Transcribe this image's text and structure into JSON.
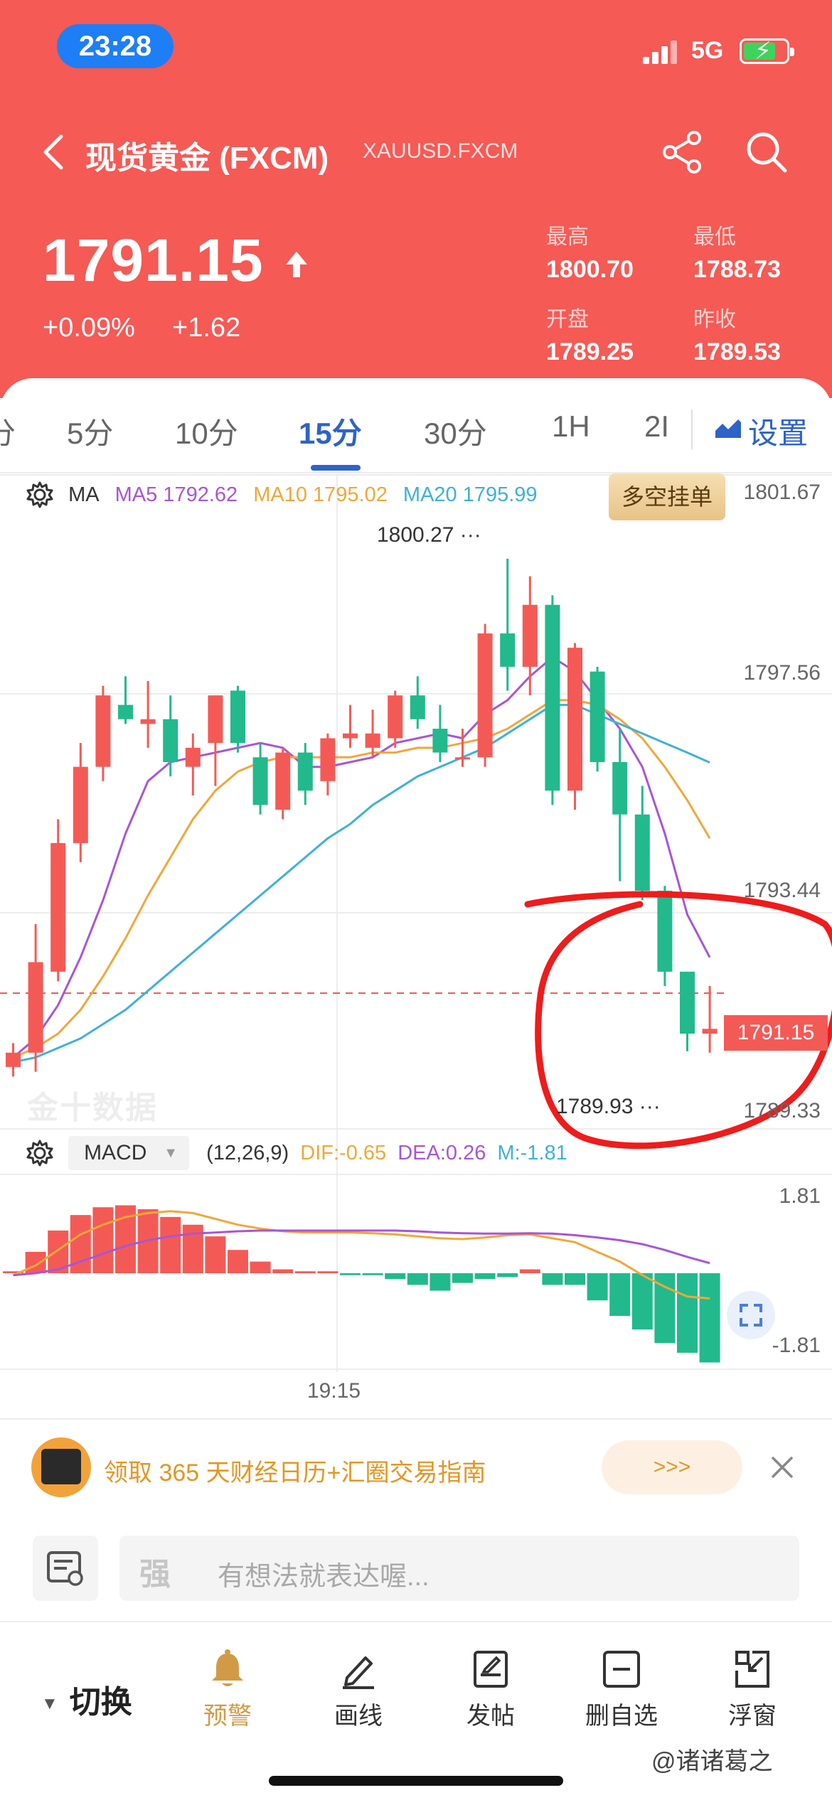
{
  "status_bar": {
    "time": "23:28",
    "network": "5G"
  },
  "nav": {
    "title": "现货黄金 (FXCM)",
    "symbol": "XAUUSD.FXCM"
  },
  "quote": {
    "price": "1791.15",
    "change_pct": "+0.09%",
    "change_abs": "+1.62",
    "high_label": "最高",
    "high": "1800.70",
    "low_label": "最低",
    "low": "1788.73",
    "open_label": "开盘",
    "open": "1789.25",
    "prev_close_label": "昨收",
    "prev_close": "1789.53"
  },
  "tabs": [
    {
      "label": "分"
    },
    {
      "label": "5分"
    },
    {
      "label": "10分"
    },
    {
      "label": "15分",
      "active": true
    },
    {
      "label": "30分"
    },
    {
      "label": "1H"
    },
    {
      "label": "2I"
    }
  ],
  "settings_label": "设置",
  "ma": {
    "label": "MA",
    "ma5": "MA5 1792.62",
    "ma10": "MA10 1795.02",
    "ma20": "MA20 1795.99",
    "colors": {
      "ma5": "#a855d6",
      "ma10": "#f0a73a",
      "ma20": "#3fb0d8"
    }
  },
  "orders_button": "多空挂单",
  "price_axis": [
    "1801.67",
    "1797.56",
    "1793.44",
    "1789.33"
  ],
  "current_price_tag": "1791.15",
  "high_marker": "1800.27 ···",
  "low_marker": "1789.93 ···",
  "watermark": "金十数据",
  "macd": {
    "name": "MACD",
    "params": "(12,26,9)",
    "dif": "DIF:-0.65",
    "dea": "DEA:0.26",
    "m": "M:-1.81",
    "axis_top": "1.81",
    "axis_bottom": "-1.81"
  },
  "time_axis_label": "19:15",
  "colors": {
    "up": "#f45a55",
    "down": "#22b98d",
    "brand": "#2d63c8",
    "header": "#f55a55",
    "annotation": "#ee1c1c"
  },
  "chart_data": {
    "type": "candlestick",
    "title": "",
    "ylim": [
      1788.3,
      1801.67
    ],
    "series_candles": [
      {
        "o": 1789.6,
        "h": 1790.1,
        "l": 1789.4,
        "c": 1789.9
      },
      {
        "o": 1789.9,
        "h": 1792.6,
        "l": 1789.5,
        "c": 1791.8
      },
      {
        "o": 1791.6,
        "h": 1794.8,
        "l": 1791.4,
        "c": 1794.3
      },
      {
        "o": 1794.3,
        "h": 1796.4,
        "l": 1793.9,
        "c": 1795.9
      },
      {
        "o": 1795.9,
        "h": 1797.6,
        "l": 1795.6,
        "c": 1797.4
      },
      {
        "o": 1797.2,
        "h": 1797.8,
        "l": 1796.8,
        "c": 1796.9
      },
      {
        "o": 1796.8,
        "h": 1797.7,
        "l": 1796.3,
        "c": 1796.9
      },
      {
        "o": 1796.9,
        "h": 1797.4,
        "l": 1795.7,
        "c": 1796.0
      },
      {
        "o": 1795.9,
        "h": 1796.6,
        "l": 1795.3,
        "c": 1796.3
      },
      {
        "o": 1796.4,
        "h": 1797.4,
        "l": 1795.5,
        "c": 1797.4
      },
      {
        "o": 1797.5,
        "h": 1797.6,
        "l": 1796.2,
        "c": 1796.4
      },
      {
        "o": 1796.1,
        "h": 1796.4,
        "l": 1794.9,
        "c": 1795.1
      },
      {
        "o": 1795.0,
        "h": 1796.3,
        "l": 1794.8,
        "c": 1796.2
      },
      {
        "o": 1796.2,
        "h": 1796.4,
        "l": 1795.1,
        "c": 1795.4
      },
      {
        "o": 1795.6,
        "h": 1796.6,
        "l": 1795.3,
        "c": 1796.5
      },
      {
        "o": 1796.5,
        "h": 1797.2,
        "l": 1796.3,
        "c": 1796.6
      },
      {
        "o": 1796.3,
        "h": 1797.1,
        "l": 1796.1,
        "c": 1796.6
      },
      {
        "o": 1796.5,
        "h": 1797.5,
        "l": 1796.3,
        "c": 1797.4
      },
      {
        "o": 1797.4,
        "h": 1797.8,
        "l": 1796.7,
        "c": 1796.9
      },
      {
        "o": 1796.7,
        "h": 1797.2,
        "l": 1796.0,
        "c": 1796.2
      },
      {
        "o": 1796.1,
        "h": 1796.7,
        "l": 1795.9,
        "c": 1796.1
      },
      {
        "o": 1796.1,
        "h": 1798.9,
        "l": 1795.9,
        "c": 1798.7
      },
      {
        "o": 1798.7,
        "h": 1800.27,
        "l": 1797.5,
        "c": 1798.0
      },
      {
        "o": 1798.0,
        "h": 1799.9,
        "l": 1797.4,
        "c": 1799.3
      },
      {
        "o": 1799.3,
        "h": 1799.5,
        "l": 1795.1,
        "c": 1795.4
      },
      {
        "o": 1795.4,
        "h": 1798.5,
        "l": 1795.0,
        "c": 1798.4
      },
      {
        "o": 1797.9,
        "h": 1798.0,
        "l": 1795.8,
        "c": 1796.0
      },
      {
        "o": 1796.0,
        "h": 1796.7,
        "l": 1793.5,
        "c": 1794.9
      },
      {
        "o": 1794.9,
        "h": 1795.5,
        "l": 1793.1,
        "c": 1793.3
      },
      {
        "o": 1793.3,
        "h": 1793.4,
        "l": 1791.3,
        "c": 1791.6
      },
      {
        "o": 1791.6,
        "h": 1791.6,
        "l": 1789.93,
        "c": 1790.3
      },
      {
        "o": 1790.3,
        "h": 1791.3,
        "l": 1789.9,
        "c": 1790.4
      }
    ],
    "ma5": [
      1789.8,
      1790.2,
      1790.9,
      1791.9,
      1793.1,
      1794.5,
      1795.6,
      1796.0,
      1796.1,
      1796.2,
      1796.3,
      1796.4,
      1796.3,
      1795.9,
      1795.9,
      1796.0,
      1796.1,
      1796.4,
      1796.5,
      1796.6,
      1796.5,
      1797.0,
      1797.3,
      1797.8,
      1798.2,
      1797.9,
      1797.3,
      1796.7,
      1795.9,
      1794.5,
      1792.8,
      1791.9
    ],
    "ma10": [
      1789.8,
      1790.0,
      1790.3,
      1790.8,
      1791.5,
      1792.3,
      1793.2,
      1794.0,
      1794.8,
      1795.4,
      1795.8,
      1796.0,
      1796.1,
      1796.1,
      1796.1,
      1796.1,
      1796.2,
      1796.2,
      1796.3,
      1796.3,
      1796.4,
      1796.5,
      1796.7,
      1797.0,
      1797.3,
      1797.3,
      1797.2,
      1796.9,
      1796.5,
      1795.9,
      1795.2,
      1794.4
    ],
    "ma20": [
      1789.7,
      1789.8,
      1790.0,
      1790.2,
      1790.5,
      1790.8,
      1791.2,
      1791.6,
      1792.0,
      1792.4,
      1792.8,
      1793.2,
      1793.6,
      1794.0,
      1794.4,
      1794.7,
      1795.1,
      1795.4,
      1795.7,
      1795.9,
      1796.1,
      1796.3,
      1796.6,
      1796.9,
      1797.2,
      1797.2,
      1797.0,
      1796.8,
      1796.6,
      1796.4,
      1796.2,
      1795.99
    ],
    "macd_hist": [
      0.05,
      0.55,
      1.1,
      1.5,
      1.7,
      1.75,
      1.65,
      1.45,
      1.25,
      0.95,
      0.6,
      0.3,
      0.1,
      0.05,
      0.05,
      -0.05,
      -0.05,
      -0.15,
      -0.3,
      -0.45,
      -0.25,
      -0.15,
      -0.1,
      0.1,
      -0.3,
      -0.3,
      -0.7,
      -1.1,
      -1.45,
      -1.8,
      -2.05,
      -2.3
    ],
    "dif": [
      -0.05,
      0.2,
      0.6,
      1.0,
      1.25,
      1.45,
      1.55,
      1.6,
      1.55,
      1.4,
      1.25,
      1.15,
      1.08,
      1.05,
      1.05,
      1.05,
      1.03,
      1.0,
      0.95,
      0.9,
      0.88,
      0.92,
      0.98,
      1.0,
      0.9,
      0.8,
      0.55,
      0.3,
      -0.05,
      -0.35,
      -0.6,
      -0.65
    ],
    "dea": [
      -0.05,
      0.0,
      0.1,
      0.3,
      0.5,
      0.7,
      0.85,
      0.95,
      1.02,
      1.05,
      1.08,
      1.1,
      1.1,
      1.1,
      1.1,
      1.1,
      1.1,
      1.1,
      1.08,
      1.05,
      1.03,
      1.02,
      1.02,
      1.03,
      1.02,
      0.98,
      0.92,
      0.85,
      0.75,
      0.6,
      0.42,
      0.26
    ],
    "macd_ylim": [
      -2.4,
      2.4
    ]
  },
  "promo": {
    "text": "领取 365 天财经日历+汇圈交易指南",
    "button": ">>>"
  },
  "comment": {
    "placeholder": "有想法就表达喔...",
    "emoji_glyph": "强"
  },
  "toolbar": {
    "switch_label": "切换",
    "items": [
      {
        "label": "预警",
        "icon": "bell-icon"
      },
      {
        "label": "画线",
        "icon": "pen-icon"
      },
      {
        "label": "发帖",
        "icon": "post-icon"
      },
      {
        "label": "删自选",
        "icon": "remove-watchlist-icon"
      },
      {
        "label": "浮窗",
        "icon": "float-window-icon"
      }
    ]
  },
  "credit": "@诸诸葛之"
}
